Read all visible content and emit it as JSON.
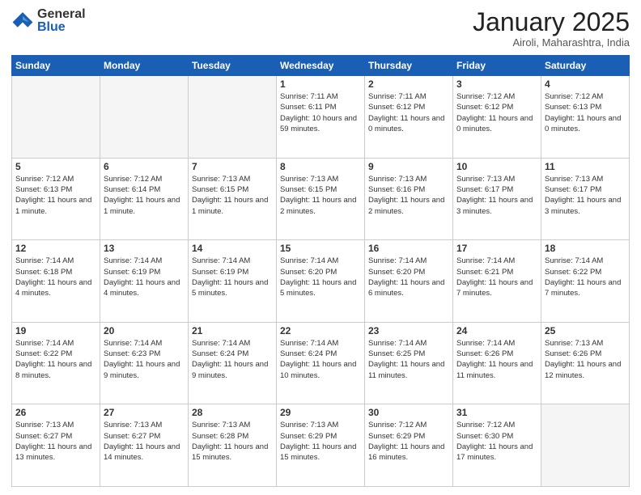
{
  "logo": {
    "general": "General",
    "blue": "Blue"
  },
  "title": "January 2025",
  "location": "Airoli, Maharashtra, India",
  "days_of_week": [
    "Sunday",
    "Monday",
    "Tuesday",
    "Wednesday",
    "Thursday",
    "Friday",
    "Saturday"
  ],
  "weeks": [
    [
      {
        "day": "",
        "empty": true
      },
      {
        "day": "",
        "empty": true
      },
      {
        "day": "",
        "empty": true
      },
      {
        "day": "1",
        "sunrise": "7:11 AM",
        "sunset": "6:11 PM",
        "daylight": "10 hours and 59 minutes."
      },
      {
        "day": "2",
        "sunrise": "7:11 AM",
        "sunset": "6:12 PM",
        "daylight": "11 hours and 0 minutes."
      },
      {
        "day": "3",
        "sunrise": "7:12 AM",
        "sunset": "6:12 PM",
        "daylight": "11 hours and 0 minutes."
      },
      {
        "day": "4",
        "sunrise": "7:12 AM",
        "sunset": "6:13 PM",
        "daylight": "11 hours and 0 minutes."
      }
    ],
    [
      {
        "day": "5",
        "sunrise": "7:12 AM",
        "sunset": "6:13 PM",
        "daylight": "11 hours and 1 minute."
      },
      {
        "day": "6",
        "sunrise": "7:12 AM",
        "sunset": "6:14 PM",
        "daylight": "11 hours and 1 minute."
      },
      {
        "day": "7",
        "sunrise": "7:13 AM",
        "sunset": "6:15 PM",
        "daylight": "11 hours and 1 minute."
      },
      {
        "day": "8",
        "sunrise": "7:13 AM",
        "sunset": "6:15 PM",
        "daylight": "11 hours and 2 minutes."
      },
      {
        "day": "9",
        "sunrise": "7:13 AM",
        "sunset": "6:16 PM",
        "daylight": "11 hours and 2 minutes."
      },
      {
        "day": "10",
        "sunrise": "7:13 AM",
        "sunset": "6:17 PM",
        "daylight": "11 hours and 3 minutes."
      },
      {
        "day": "11",
        "sunrise": "7:13 AM",
        "sunset": "6:17 PM",
        "daylight": "11 hours and 3 minutes."
      }
    ],
    [
      {
        "day": "12",
        "sunrise": "7:14 AM",
        "sunset": "6:18 PM",
        "daylight": "11 hours and 4 minutes."
      },
      {
        "day": "13",
        "sunrise": "7:14 AM",
        "sunset": "6:19 PM",
        "daylight": "11 hours and 4 minutes."
      },
      {
        "day": "14",
        "sunrise": "7:14 AM",
        "sunset": "6:19 PM",
        "daylight": "11 hours and 5 minutes."
      },
      {
        "day": "15",
        "sunrise": "7:14 AM",
        "sunset": "6:20 PM",
        "daylight": "11 hours and 5 minutes."
      },
      {
        "day": "16",
        "sunrise": "7:14 AM",
        "sunset": "6:20 PM",
        "daylight": "11 hours and 6 minutes."
      },
      {
        "day": "17",
        "sunrise": "7:14 AM",
        "sunset": "6:21 PM",
        "daylight": "11 hours and 7 minutes."
      },
      {
        "day": "18",
        "sunrise": "7:14 AM",
        "sunset": "6:22 PM",
        "daylight": "11 hours and 7 minutes."
      }
    ],
    [
      {
        "day": "19",
        "sunrise": "7:14 AM",
        "sunset": "6:22 PM",
        "daylight": "11 hours and 8 minutes."
      },
      {
        "day": "20",
        "sunrise": "7:14 AM",
        "sunset": "6:23 PM",
        "daylight": "11 hours and 9 minutes."
      },
      {
        "day": "21",
        "sunrise": "7:14 AM",
        "sunset": "6:24 PM",
        "daylight": "11 hours and 9 minutes."
      },
      {
        "day": "22",
        "sunrise": "7:14 AM",
        "sunset": "6:24 PM",
        "daylight": "11 hours and 10 minutes."
      },
      {
        "day": "23",
        "sunrise": "7:14 AM",
        "sunset": "6:25 PM",
        "daylight": "11 hours and 11 minutes."
      },
      {
        "day": "24",
        "sunrise": "7:14 AM",
        "sunset": "6:26 PM",
        "daylight": "11 hours and 11 minutes."
      },
      {
        "day": "25",
        "sunrise": "7:13 AM",
        "sunset": "6:26 PM",
        "daylight": "11 hours and 12 minutes."
      }
    ],
    [
      {
        "day": "26",
        "sunrise": "7:13 AM",
        "sunset": "6:27 PM",
        "daylight": "11 hours and 13 minutes."
      },
      {
        "day": "27",
        "sunrise": "7:13 AM",
        "sunset": "6:27 PM",
        "daylight": "11 hours and 14 minutes."
      },
      {
        "day": "28",
        "sunrise": "7:13 AM",
        "sunset": "6:28 PM",
        "daylight": "11 hours and 15 minutes."
      },
      {
        "day": "29",
        "sunrise": "7:13 AM",
        "sunset": "6:29 PM",
        "daylight": "11 hours and 15 minutes."
      },
      {
        "day": "30",
        "sunrise": "7:12 AM",
        "sunset": "6:29 PM",
        "daylight": "11 hours and 16 minutes."
      },
      {
        "day": "31",
        "sunrise": "7:12 AM",
        "sunset": "6:30 PM",
        "daylight": "11 hours and 17 minutes."
      },
      {
        "day": "",
        "empty": true
      }
    ]
  ]
}
